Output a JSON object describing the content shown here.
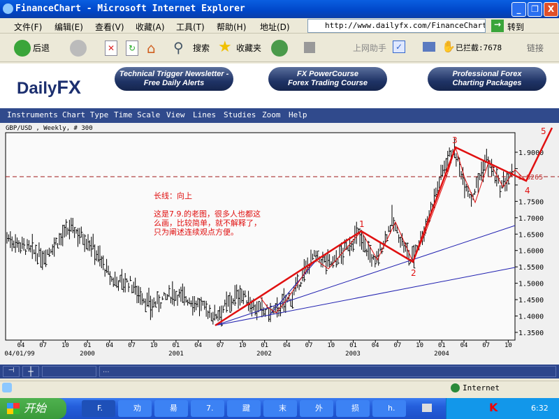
{
  "window": {
    "title": "FinanceChart - Microsoft Internet Explorer",
    "min": "_",
    "max": "❐",
    "close": "X"
  },
  "menu": [
    "文件(F)",
    "编辑(E)",
    "查看(V)",
    "收藏(A)",
    "工具(T)",
    "帮助(H)"
  ],
  "address": {
    "label": "地址(D)",
    "url": "http://www.dailyfx.com/FinanceChart.",
    "go": "转到"
  },
  "toolbar": {
    "back": "后退",
    "search": "搜索",
    "favorites": "收藏夹",
    "assistant": "上网助手",
    "blocked": "已拦截:7678",
    "links": "链接"
  },
  "banner": {
    "logo_a": "Daily",
    "logo_b": "FX",
    "pills": [
      [
        "Technical Trigger Newsletter -",
        "Free Daily Alerts"
      ],
      [
        "FX PowerCourse",
        "Forex Trading Course"
      ],
      [
        "Professional Forex",
        "Charting Packages"
      ]
    ]
  },
  "nav": [
    "Instruments",
    "Chart Type",
    "Time Scale",
    "View",
    "Lines",
    "Studies",
    "Zoom",
    "Help"
  ],
  "chart_data": {
    "type": "ohlc",
    "title": "GBP/USD , Weekly, # 300",
    "ylim": [
      1.33,
      1.96
    ],
    "yticks": [
      "1.9000",
      "1.8500",
      "1.8000",
      "1.7500",
      "1.7000",
      "1.6500",
      "1.6000",
      "1.5500",
      "1.5000",
      "1.4500",
      "1.4000",
      "1.3500"
    ],
    "current_price": "1.8265",
    "xticks": [
      "04",
      "07",
      "10",
      "01",
      "04",
      "07",
      "10",
      "01",
      "04",
      "07",
      "10",
      "01",
      "04",
      "07",
      "10",
      "01",
      "04",
      "07",
      "10",
      "01",
      "04",
      "07",
      "10"
    ],
    "years": [
      "04/01/99",
      "2000",
      "2001",
      "2002",
      "2003",
      "2004"
    ],
    "weeks": 300,
    "path": [
      [
        0,
        1.64
      ],
      [
        21,
        1.58
      ],
      [
        38,
        1.67
      ],
      [
        50,
        1.62
      ],
      [
        62,
        1.51
      ],
      [
        73,
        1.5
      ],
      [
        85,
        1.43
      ],
      [
        99,
        1.47
      ],
      [
        112,
        1.44
      ],
      [
        123,
        1.4
      ],
      [
        138,
        1.47
      ],
      [
        148,
        1.42
      ],
      [
        158,
        1.41
      ],
      [
        169,
        1.46
      ],
      [
        181,
        1.58
      ],
      [
        193,
        1.56
      ],
      [
        208,
        1.65
      ],
      [
        218,
        1.56
      ],
      [
        228,
        1.69
      ],
      [
        239,
        1.57
      ],
      [
        247,
        1.66
      ],
      [
        259,
        1.86
      ],
      [
        264,
        1.91
      ],
      [
        275,
        1.76
      ],
      [
        284,
        1.88
      ],
      [
        292,
        1.79
      ],
      [
        299,
        1.83
      ]
    ],
    "wave_labels": [
      "1",
      "2",
      "3",
      "4",
      "5"
    ]
  },
  "annotation": {
    "line1": "长线：向上",
    "line2": "这是7.9.的老图，很多人也都这",
    "line3": "么画，比较简单，就不解释了，",
    "line4": "只为阐述连续观点方便。"
  },
  "bottombar": {
    "dots": "..."
  },
  "status": {
    "zone": "Internet"
  },
  "taskbar": {
    "start": "开始",
    "tasks": [
      "F.",
      "劝",
      "昜",
      "7.",
      "踺",
      "末",
      "外",
      "损",
      "h."
    ],
    "clock": "6:32"
  }
}
